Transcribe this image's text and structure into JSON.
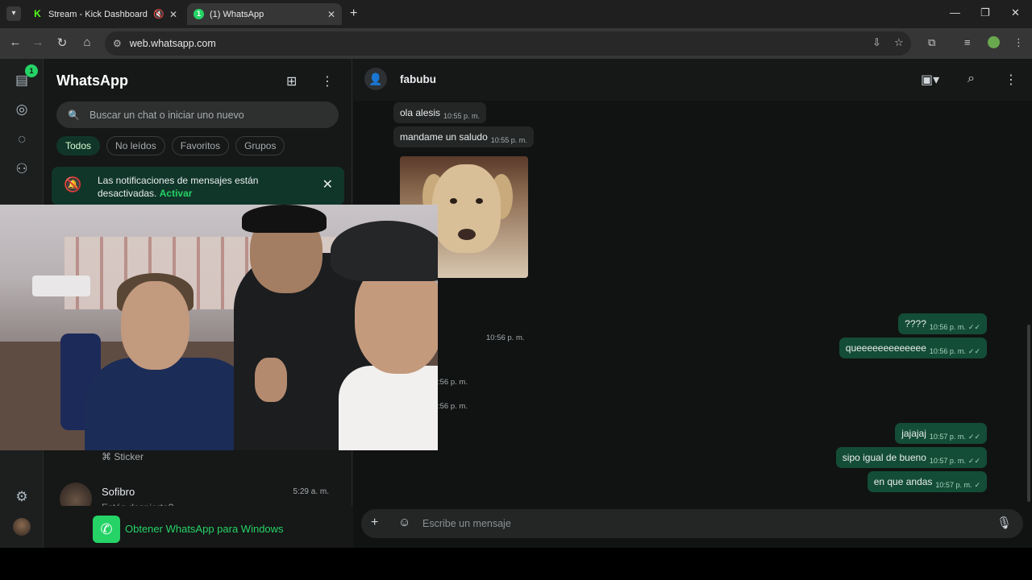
{
  "browser": {
    "tabs": [
      {
        "title": "Stream - Kick Dashboard",
        "favicon": "K"
      },
      {
        "title": "(1) WhatsApp",
        "favicon": "1"
      }
    ],
    "url": "web.whatsapp.com"
  },
  "rail": {
    "badge": "1"
  },
  "sidebar": {
    "title": "WhatsApp",
    "search_placeholder": "Buscar un chat o iniciar uno nuevo",
    "filters": [
      "Todos",
      "No leídos",
      "Favoritos",
      "Grupos"
    ],
    "notification": {
      "text": "Las notificaciones de mensajes están desactivadas.",
      "action": "Activar"
    },
    "sticker_preview": "Sticker",
    "chat": {
      "name": "Sofibro",
      "time": "5:29 a. m.",
      "preview": "Estás despierto?"
    },
    "get_app": "Obtener WhatsApp para Windows"
  },
  "conversation": {
    "contact": "fabubu",
    "messages": {
      "m1": {
        "text": "ola alesis",
        "time": "10:55 p. m."
      },
      "m2": {
        "text": "mandame un saludo",
        "time": "10:55 p. m."
      },
      "photo_time": "10:56 p. m.",
      "m3": {
        "text": "????",
        "time": "10:56 p. m."
      },
      "m4": {
        "text": "queeeeeeeeeeeee",
        "time": "10:56 p. m."
      },
      "partial1": ":56 p. m.",
      "partial2": ":56 p. m.",
      "m5": {
        "text": "jajajaj",
        "time": "10:57 p. m."
      },
      "m6": {
        "text": "sipo igual de bueno",
        "time": "10:57 p. m."
      },
      "m7": {
        "text": "en que andas",
        "time": "10:57 p. m."
      }
    },
    "composer_placeholder": "Escribe un mensaje"
  },
  "colors": {
    "accent": "#25d366",
    "outgoing": "#144d37",
    "incoming": "#242626"
  }
}
